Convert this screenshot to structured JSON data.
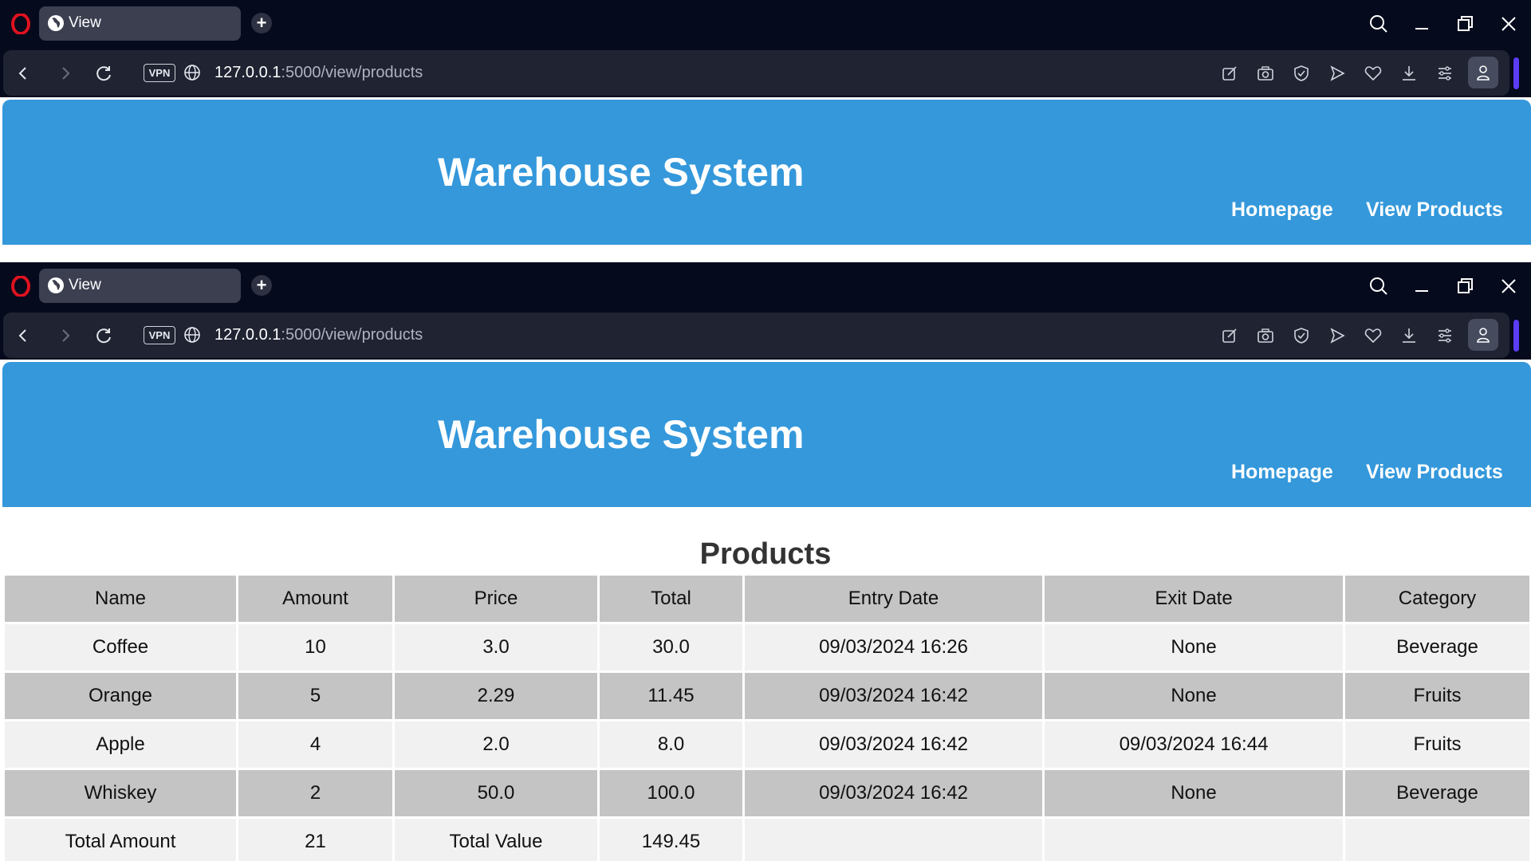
{
  "browser": {
    "tab_title": "View",
    "new_tab_symbol": "+",
    "vpn_label": "VPN",
    "url_host": "127.0.0.1",
    "url_path": ":5000/view/products"
  },
  "site": {
    "title": "Warehouse System",
    "nav": {
      "homepage": "Homepage",
      "view_products": "View Products"
    }
  },
  "products": {
    "heading": "Products",
    "columns": [
      "Name",
      "Amount",
      "Price",
      "Total",
      "Entry Date",
      "Exit Date",
      "Category"
    ],
    "rows": [
      [
        "Coffee",
        "10",
        "3.0",
        "30.0",
        "09/03/2024 16:26",
        "None",
        "Beverage"
      ],
      [
        "Orange",
        "5",
        "2.29",
        "11.45",
        "09/03/2024 16:42",
        "None",
        "Fruits"
      ],
      [
        "Apple",
        "4",
        "2.0",
        "8.0",
        "09/03/2024 16:42",
        "09/03/2024 16:44",
        "Fruits"
      ],
      [
        "Whiskey",
        "2",
        "50.0",
        "100.0",
        "09/03/2024 16:42",
        "None",
        "Beverage"
      ]
    ],
    "totals": [
      "Total Amount",
      "21",
      "Total Value",
      "149.45",
      "",
      "",
      ""
    ]
  },
  "colors": {
    "browser_chrome": "#050a1c",
    "address_bar": "#1f2332",
    "header_blue": "#3498db",
    "opera_red": "#e0121f",
    "sidebar_accent": "#5b3df5",
    "table_dark_row": "#c4c4c4",
    "table_light_row": "#f1f1f1"
  },
  "icons": {
    "browser_logo": "opera-logo-icon",
    "toolbar": [
      "edit-icon",
      "camera-icon",
      "shield-icon",
      "send-icon",
      "heart-icon",
      "download-icon",
      "easy-setup-icon",
      "profile-icon"
    ],
    "window_controls": [
      "search-icon",
      "minimize-icon",
      "restore-icon",
      "close-icon"
    ]
  }
}
